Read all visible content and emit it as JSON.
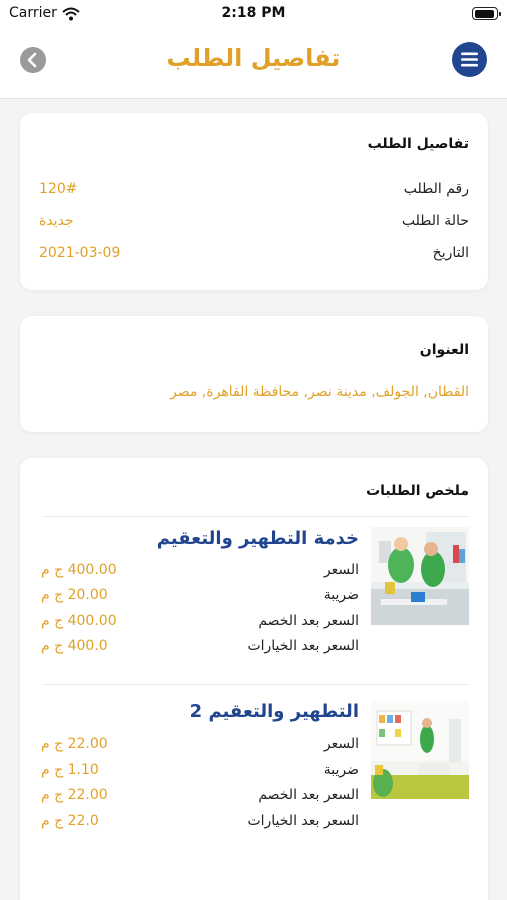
{
  "status_bar": {
    "carrier": "Carrier",
    "time": "2:18 PM"
  },
  "header": {
    "title": "تفاصيل الطلب",
    "back_icon": "chevron-left-icon",
    "menu_icon": "hamburger-menu-icon"
  },
  "order_details": {
    "title": "تفاصيل الطلب",
    "rows": [
      {
        "label": "رقم الطلب",
        "value": "120#"
      },
      {
        "label": "حالة الطلب",
        "value": "جديدة"
      },
      {
        "label": "التاريخ",
        "value": "2021-03-09"
      }
    ]
  },
  "address": {
    "title": "العنوان",
    "text": "القطان, الجولف, مدينة نصر, محافظة القاهرة, مصر"
  },
  "summary": {
    "title": "ملخص الطلبات",
    "items": [
      {
        "name": "خدمة التطهير والتعقيم",
        "rows": [
          {
            "label": "السعر",
            "value": "400.00 ج م"
          },
          {
            "label": "ضريبة",
            "value": "20.00 ج م"
          },
          {
            "label": "السعر بعد الخصم",
            "value": "400.00 ج م"
          },
          {
            "label": "السعر بعد الخيارات",
            "value": "400.0 ج م"
          }
        ]
      },
      {
        "name": "التطهير والتعقيم 2",
        "rows": [
          {
            "label": "السعر",
            "value": "22.00 ج م"
          },
          {
            "label": "ضريبة",
            "value": "1.10 ج م"
          },
          {
            "label": "السعر بعد الخصم",
            "value": "22.00 ج م"
          },
          {
            "label": "السعر بعد الخيارات",
            "value": "22.0 ج م"
          }
        ]
      }
    ]
  },
  "colors": {
    "accent": "#e1a128",
    "primary": "#21468f",
    "background": "#f4f4f6"
  }
}
